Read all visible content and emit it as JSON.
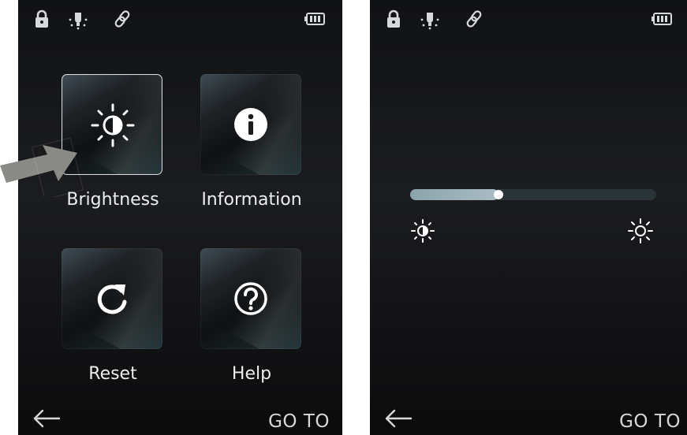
{
  "left_screen": {
    "status": {
      "icons": [
        "lock-icon",
        "bulb-icon",
        "link-icon",
        "battery-icon"
      ]
    },
    "menu": {
      "items": [
        {
          "label": "Brightness",
          "icon": "brightness-icon",
          "selected": true
        },
        {
          "label": "Information",
          "icon": "info-icon",
          "selected": false
        },
        {
          "label": "Reset",
          "icon": "reset-icon",
          "selected": false
        },
        {
          "label": "Help",
          "icon": "help-icon",
          "selected": false
        }
      ]
    },
    "footer": {
      "back_icon": "back-arrow-icon",
      "goto_label": "GO TO"
    }
  },
  "right_screen": {
    "status": {
      "icons": [
        "lock-icon",
        "bulb-icon",
        "link-icon",
        "battery-icon"
      ]
    },
    "brightness": {
      "level": 0.36,
      "min_icon": "brightness-low-icon",
      "max_icon": "brightness-high-icon"
    },
    "footer": {
      "back_icon": "back-arrow-icon",
      "goto_label": "GO TO"
    }
  },
  "colors": {
    "screen_bg": "#141517",
    "accent": "#9fb4bc",
    "text": "#eceeef",
    "pointer": "#8a8a86"
  }
}
